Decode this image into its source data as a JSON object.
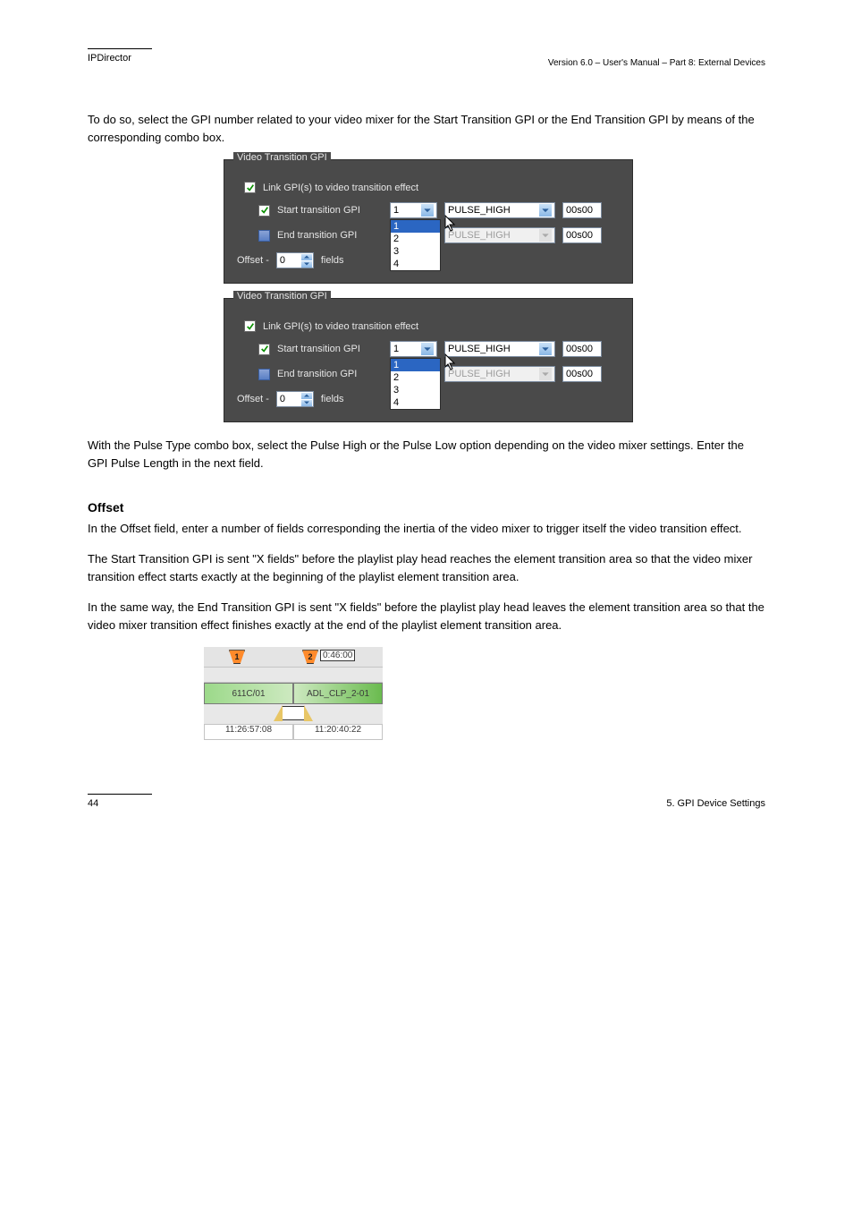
{
  "header": {
    "app": "IPDirector",
    "doc": "Version 6.0 – User's Manual – Part 8: External Devices"
  },
  "para1": "To do so, select the GPI number related to your video mixer for the Start Transition GPI or the End Transition GPI by means of the corresponding combo box.",
  "panel": {
    "title": "Video Transition GPI",
    "link_label": "Link GPI(s) to video transition effect",
    "start_label": "Start transition GPI",
    "end_label": "End transition GPI",
    "num_field": "1",
    "options": [
      "1",
      "2",
      "3",
      "4"
    ],
    "type_enabled": "PULSE_HIGH",
    "type_disabled": "PULSE_HIGH",
    "dur1": "00s00",
    "dur2": "00s00",
    "offset_label": "Offset -",
    "offset_val": "0",
    "fields_label": "fields"
  },
  "para2": "With the Pulse Type combo box, select the Pulse High or the Pulse Low option depending on the video mixer settings. Enter the GPI Pulse Length in the next field.",
  "h3": "Offset",
  "para3": "In the Offset field, enter a number of fields corresponding the inertia of the video mixer to trigger itself the video transition effect.",
  "para4": "The Start Transition GPI is sent \"X fields\" before the playlist play head reaches the element transition area so that the video mixer transition effect starts exactly at the beginning of the playlist element transition area.",
  "para5": "In the same way, the End Transition GPI is sent \"X fields\" before the playlist play head leaves the element transition area so that the video mixer transition effect finishes exactly at the end of the playlist element transition area.",
  "timeline": {
    "time_label": "0:46:00",
    "mark1": "1",
    "mark2": "2",
    "clip_a": "611C/01",
    "clip_b": "ADL_CLP_2-01",
    "tc_a": "11:26:57:08",
    "tc_b": "11:20:40:22"
  },
  "footer": {
    "left": "44",
    "right": "5. GPI Device Settings"
  }
}
